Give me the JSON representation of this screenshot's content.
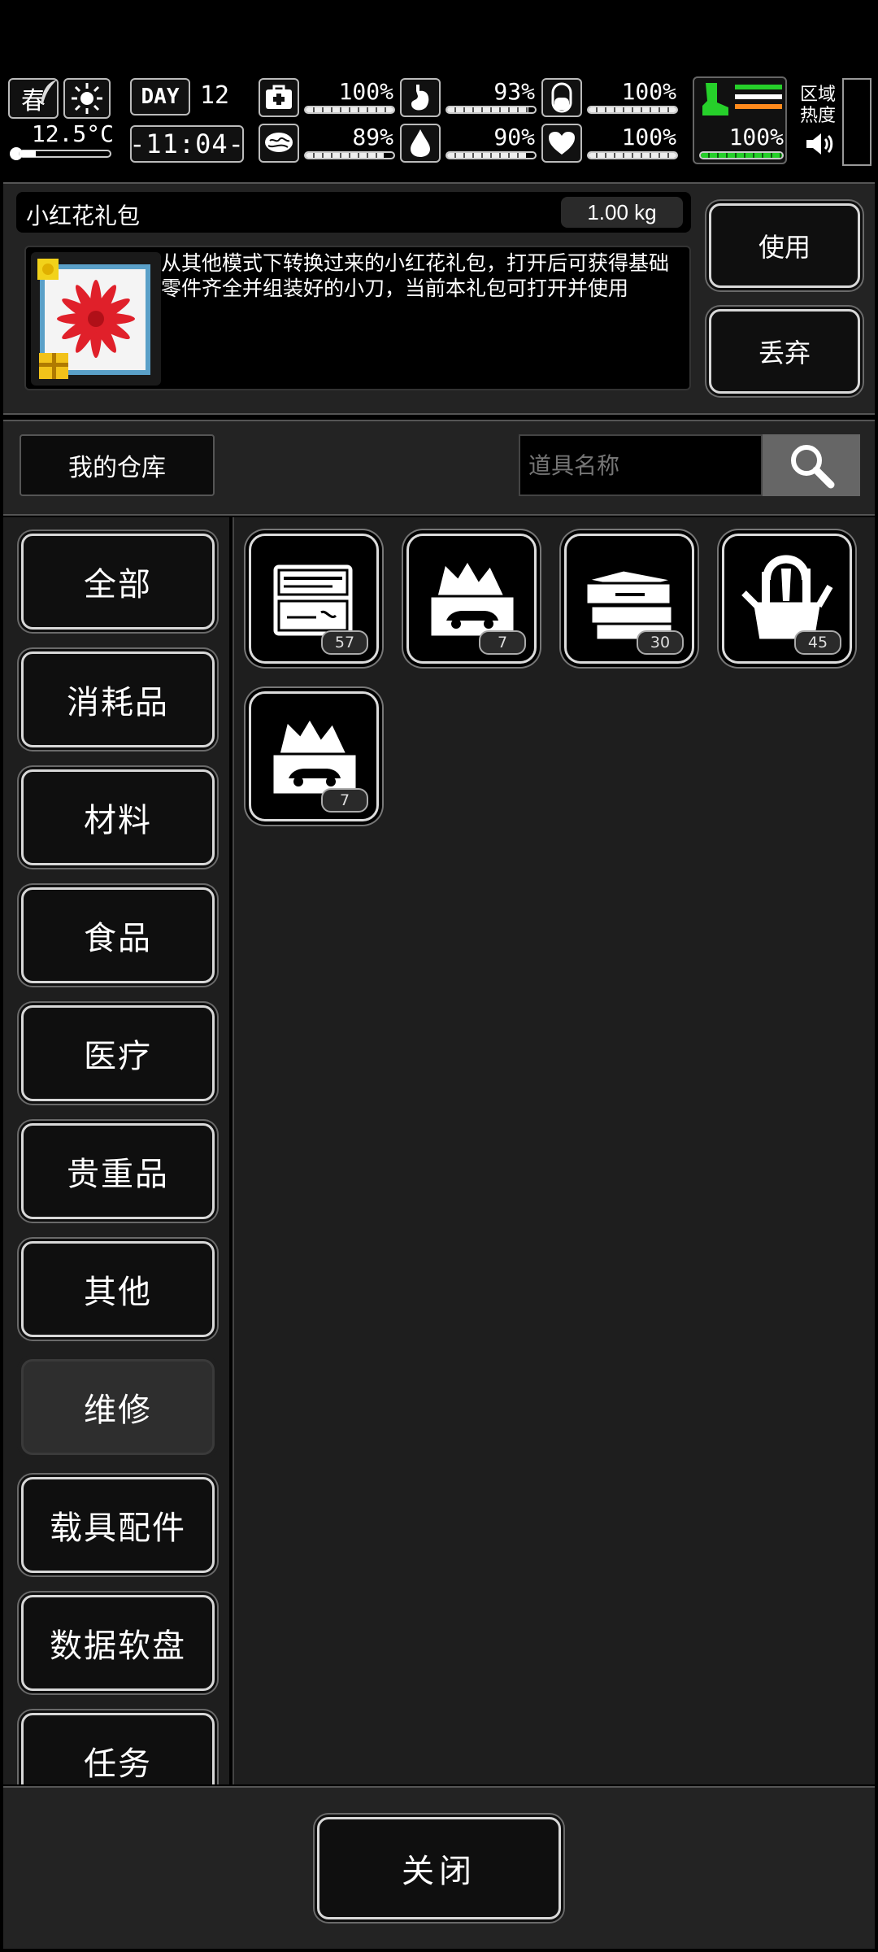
{
  "status": {
    "season": "春",
    "temperature": "12.5°C",
    "day_label": "DAY",
    "day_number": "12",
    "time": "-11:04-",
    "stats": [
      {
        "name": "health",
        "label": "100%",
        "level": 1.0
      },
      {
        "name": "hunger",
        "label": "93%",
        "level": 0.93
      },
      {
        "name": "medicine",
        "label": "100%",
        "level": 1.0
      },
      {
        "name": "mental",
        "label": "89%",
        "level": 0.89
      },
      {
        "name": "thirst",
        "label": "90%",
        "level": 0.9
      },
      {
        "name": "heart",
        "label": "100%",
        "level": 1.0
      }
    ],
    "stamina": {
      "label": "100%",
      "level": 1.0
    },
    "area_heat_label": "区域\n热度"
  },
  "item_detail": {
    "name": "小红花礼包",
    "weight": "1.00 kg",
    "description": "从其他模式下转换过来的小红花礼包，打开后可获得基础零件齐全并组装好的小刀，当前本礼包可打开并使用",
    "use_button": "使用",
    "discard_button": "丢弃"
  },
  "warehouse": {
    "title": "我的仓库",
    "search_placeholder": "道具名称"
  },
  "categories": [
    "全部",
    "消耗品",
    "材料",
    "食品",
    "医疗",
    "贵重品",
    "其他",
    "维修",
    "载具配件",
    "数据软盘",
    "任务"
  ],
  "active_category": "维修",
  "items": [
    {
      "name": "tool-kit-icon",
      "count": "57"
    },
    {
      "name": "car-repair-toolbox-icon",
      "count": "7"
    },
    {
      "name": "open-toolbox-icon",
      "count": "30"
    },
    {
      "name": "tool-bag-icon",
      "count": "45"
    },
    {
      "name": "car-repair-toolbox-icon",
      "count": "7"
    }
  ],
  "close_button": "关闭",
  "colors": {
    "accent_green": "#26d02a",
    "accent_orange": "#ff8a1c",
    "gift_red": "#e0202a",
    "panel_bg": "#232323"
  }
}
